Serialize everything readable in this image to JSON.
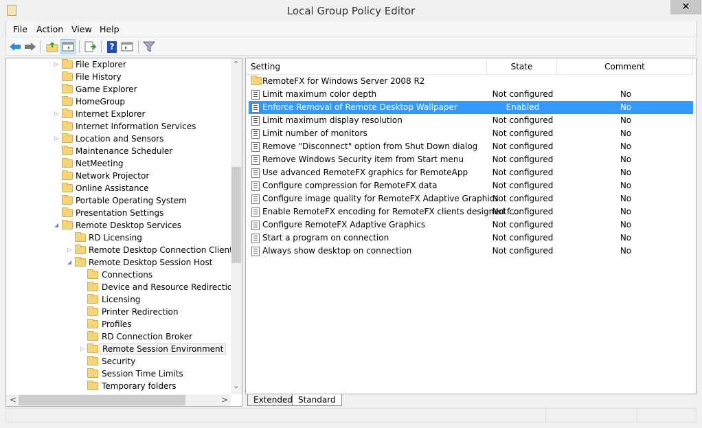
{
  "window": {
    "title": "Local Group Policy Editor",
    "close": "✕"
  },
  "menu": [
    "File",
    "Action",
    "View",
    "Help"
  ],
  "toolbar": {
    "icons": [
      "back-arrow-icon",
      "forward-arrow-icon",
      "up-folder-icon",
      "show-hide-tree-icon",
      "export-list-icon",
      "help-icon",
      "show-hide-action-pane-icon",
      "filter-icon"
    ],
    "help_glyph": "?"
  },
  "tree": [
    {
      "label": "File Explorer",
      "level": 1,
      "expander": "▷"
    },
    {
      "label": "File History",
      "level": 1
    },
    {
      "label": "Game Explorer",
      "level": 1
    },
    {
      "label": "HomeGroup",
      "level": 1
    },
    {
      "label": "Internet Explorer",
      "level": 1,
      "expander": "▷"
    },
    {
      "label": "Internet Information Services",
      "level": 1
    },
    {
      "label": "Location and Sensors",
      "level": 1,
      "expander": "▷"
    },
    {
      "label": "Maintenance Scheduler",
      "level": 1
    },
    {
      "label": "NetMeeting",
      "level": 1
    },
    {
      "label": "Network Projector",
      "level": 1
    },
    {
      "label": "Online Assistance",
      "level": 1
    },
    {
      "label": "Portable Operating System",
      "level": 1
    },
    {
      "label": "Presentation Settings",
      "level": 1
    },
    {
      "label": "Remote Desktop Services",
      "level": 1,
      "expander": "◢"
    },
    {
      "label": "RD Licensing",
      "level": 2
    },
    {
      "label": "Remote Desktop Connection Client",
      "level": 2,
      "expander": "▷"
    },
    {
      "label": "Remote Desktop Session Host",
      "level": 2,
      "expander": "◢"
    },
    {
      "label": "Connections",
      "level": 3
    },
    {
      "label": "Device and Resource Redirection",
      "level": 3
    },
    {
      "label": "Licensing",
      "level": 3
    },
    {
      "label": "Printer Redirection",
      "level": 3
    },
    {
      "label": "Profiles",
      "level": 3
    },
    {
      "label": "RD Connection Broker",
      "level": 3
    },
    {
      "label": "Remote Session Environment",
      "level": 3,
      "expander": "▷",
      "selected": true
    },
    {
      "label": "Security",
      "level": 3
    },
    {
      "label": "Session Time Limits",
      "level": 3
    },
    {
      "label": "Temporary folders",
      "level": 3
    }
  ],
  "scroll": {
    "up": "⌃",
    "down": "⌄",
    "left": "<",
    "right": ">"
  },
  "columns": {
    "setting": "Setting",
    "state": "State",
    "comment": "Comment"
  },
  "folder_row": "RemoteFX for Windows Server 2008 R2",
  "settings": [
    {
      "name": "Limit maximum color depth",
      "state": "Not configured",
      "comment": "No"
    },
    {
      "name": "Enforce Removal of Remote Desktop Wallpaper",
      "state": "Enabled",
      "comment": "No",
      "selected": true
    },
    {
      "name": "Limit maximum display resolution",
      "state": "Not configured",
      "comment": "No"
    },
    {
      "name": "Limit number of monitors",
      "state": "Not configured",
      "comment": "No"
    },
    {
      "name": "Remove \"Disconnect\" option from Shut Down dialog",
      "state": "Not configured",
      "comment": "No"
    },
    {
      "name": "Remove Windows Security item from Start menu",
      "state": "Not configured",
      "comment": "No"
    },
    {
      "name": "Use advanced RemoteFX graphics for RemoteApp",
      "state": "Not configured",
      "comment": "No"
    },
    {
      "name": "Configure compression for RemoteFX data",
      "state": "Not configured",
      "comment": "No"
    },
    {
      "name": "Configure image quality for RemoteFX Adaptive Graphics",
      "state": "Not configured",
      "comment": "No"
    },
    {
      "name": "Enable RemoteFX encoding for RemoteFX clients designed f...",
      "state": "Not configured",
      "comment": "No"
    },
    {
      "name": "Configure RemoteFX Adaptive Graphics",
      "state": "Not configured",
      "comment": "No"
    },
    {
      "name": "Start a program on connection",
      "state": "Not configured",
      "comment": "No"
    },
    {
      "name": "Always show desktop on connection",
      "state": "Not configured",
      "comment": "No"
    }
  ],
  "tabs": [
    "Extended",
    "Standard"
  ],
  "colors": {
    "selection": "#3399ff"
  }
}
